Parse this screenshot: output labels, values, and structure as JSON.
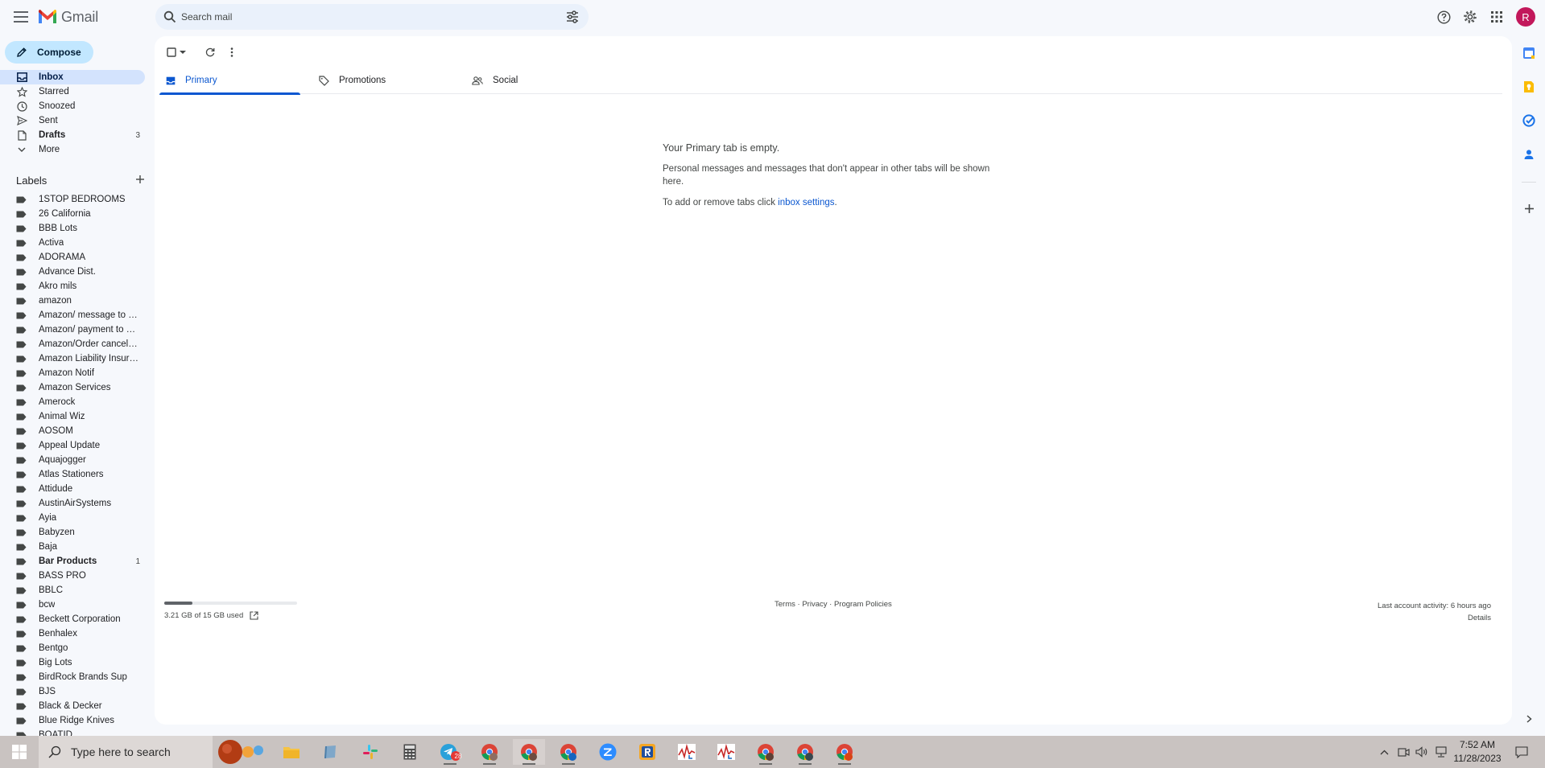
{
  "header": {
    "app_name": "Gmail",
    "search_placeholder": "Search mail",
    "avatar_initial": "R",
    "accent": "#0b57d0"
  },
  "compose": {
    "label": "Compose"
  },
  "nav": [
    {
      "label": "Inbox",
      "icon": "inbox-icon",
      "count": "",
      "active": true
    },
    {
      "label": "Starred",
      "icon": "star-icon",
      "count": ""
    },
    {
      "label": "Snoozed",
      "icon": "clock-icon",
      "count": ""
    },
    {
      "label": "Sent",
      "icon": "send-icon",
      "count": ""
    },
    {
      "label": "Drafts",
      "icon": "draft-icon",
      "count": "3",
      "bold": true
    },
    {
      "label": "More",
      "icon": "chevron-down-icon",
      "count": ""
    }
  ],
  "labels": {
    "title": "Labels",
    "items": [
      {
        "label": "1STOP BEDROOMS"
      },
      {
        "label": "26 California"
      },
      {
        "label": "BBB Lots"
      },
      {
        "label": "Activa"
      },
      {
        "label": "ADORAMA"
      },
      {
        "label": "Advance Dist."
      },
      {
        "label": "Akro mils"
      },
      {
        "label": "amazon"
      },
      {
        "label": "Amazon/ message to b..."
      },
      {
        "label": "Amazon/ payment to cli..."
      },
      {
        "label": "Amazon/Order cancella..."
      },
      {
        "label": "Amazon Liability Insura..."
      },
      {
        "label": "Amazon Notif"
      },
      {
        "label": "Amazon Services"
      },
      {
        "label": "Amerock"
      },
      {
        "label": "Animal Wiz"
      },
      {
        "label": "AOSOM"
      },
      {
        "label": "Appeal Update"
      },
      {
        "label": "Aquajogger"
      },
      {
        "label": "Atlas Stationers"
      },
      {
        "label": "Attidude"
      },
      {
        "label": "AustinAirSystems"
      },
      {
        "label": "Ayia"
      },
      {
        "label": "Babyzen"
      },
      {
        "label": "Baja"
      },
      {
        "label": "Bar Products",
        "count": "1",
        "bold": true
      },
      {
        "label": "BASS PRO"
      },
      {
        "label": "BBLC"
      },
      {
        "label": "bcw"
      },
      {
        "label": "Beckett Corporation"
      },
      {
        "label": "Benhalex"
      },
      {
        "label": "Bentgo"
      },
      {
        "label": "Big Lots"
      },
      {
        "label": "BirdRock Brands Sup"
      },
      {
        "label": "BJS"
      },
      {
        "label": "Black & Decker"
      },
      {
        "label": "Blue Ridge Knives"
      },
      {
        "label": "BOATID"
      }
    ]
  },
  "tabs": [
    {
      "label": "Primary",
      "icon": "inbox-icon",
      "active": true
    },
    {
      "label": "Promotions",
      "icon": "tag-icon"
    },
    {
      "label": "Social",
      "icon": "people-icon"
    }
  ],
  "empty_state": {
    "heading": "Your Primary tab is empty.",
    "line1": "Personal messages and messages that don't appear in other tabs will be shown here.",
    "line2_prefix": "To add or remove tabs click ",
    "line2_link": "inbox settings",
    "line2_suffix": "."
  },
  "footer": {
    "storage_text": "3.21 GB of 15 GB used",
    "storage_fraction": 0.214,
    "links": [
      "Terms",
      "Privacy",
      "Program Policies"
    ],
    "separator": " · ",
    "last_activity": "Last account activity: 6 hours ago",
    "details": "Details"
  },
  "taskbar": {
    "search_placeholder": "Type here to search",
    "time": "7:52 AM",
    "date": "11/28/2023",
    "telegram_badge": "28"
  }
}
